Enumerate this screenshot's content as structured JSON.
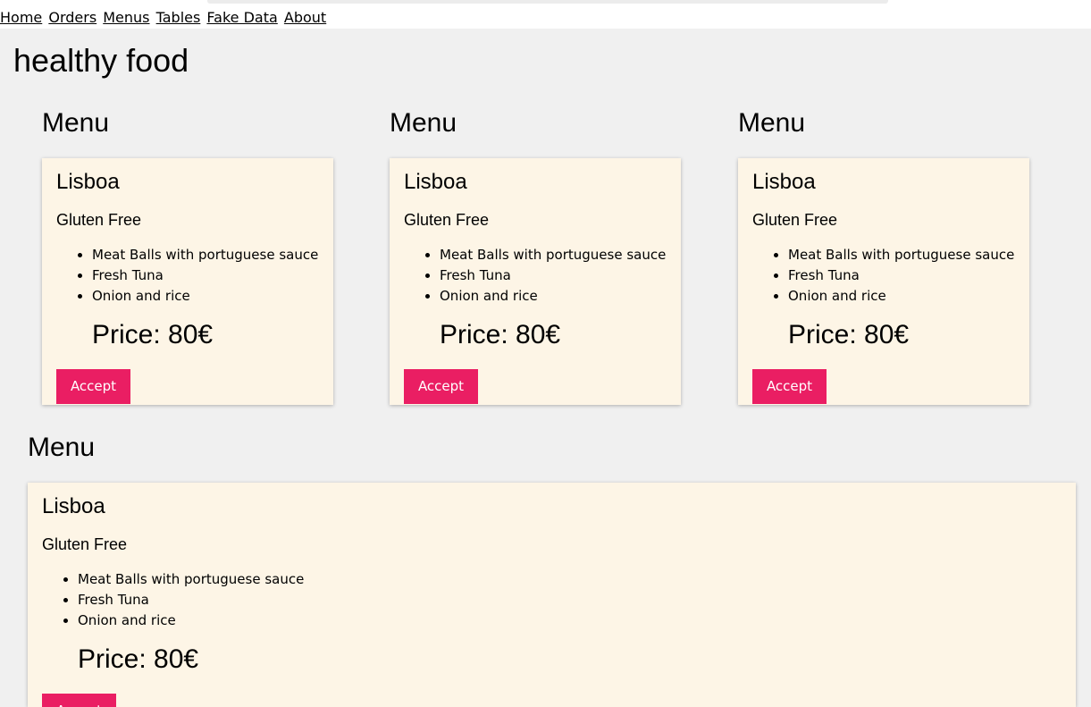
{
  "nav": {
    "items": [
      "Home",
      "Orders",
      "Menus",
      "Tables",
      "Fake Data",
      "About"
    ]
  },
  "page": {
    "title": "healthy food"
  },
  "menus": [
    {
      "heading": "Menu",
      "card": {
        "title": "Lisboa",
        "tag": "Gluten Free",
        "items": [
          "Meat Balls with portuguese sauce",
          "Fresh Tuna",
          "Onion and rice"
        ],
        "price": "Price: 80€",
        "button_label": "Accept"
      }
    },
    {
      "heading": "Menu",
      "card": {
        "title": "Lisboa",
        "tag": "Gluten Free",
        "items": [
          "Meat Balls with portuguese sauce",
          "Fresh Tuna",
          "Onion and rice"
        ],
        "price": "Price: 80€",
        "button_label": "Accept"
      }
    },
    {
      "heading": "Menu",
      "card": {
        "title": "Lisboa",
        "tag": "Gluten Free",
        "items": [
          "Meat Balls with portuguese sauce",
          "Fresh Tuna",
          "Onion and rice"
        ],
        "price": "Price: 80€",
        "button_label": "Accept"
      }
    },
    {
      "heading": "Menu",
      "card": {
        "title": "Lisboa",
        "tag": "Gluten Free",
        "items": [
          "Meat Balls with portuguese sauce",
          "Fresh Tuna",
          "Onion and rice"
        ],
        "price": "Price: 80€",
        "button_label": "Accept"
      }
    }
  ],
  "colors": {
    "page_bg": "#f0f0f0",
    "card_bg": "#fdf5e6",
    "accent": "#ea1e63"
  }
}
